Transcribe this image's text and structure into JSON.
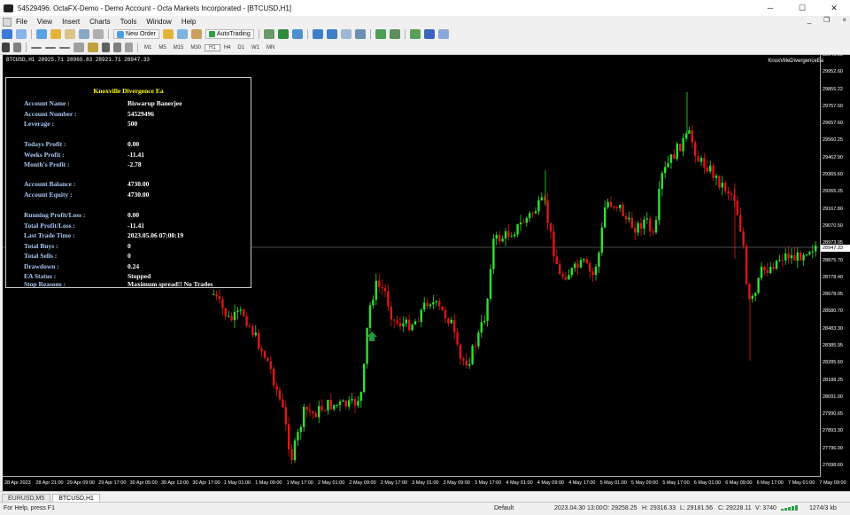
{
  "window": {
    "title": "54529496: OctaFX-Demo - Demo Account - Octa Markets Incorporated - [BTCUSD,H1]",
    "minimize": "─",
    "maximize": "☐",
    "close": "✕"
  },
  "menu": {
    "items": [
      "File",
      "View",
      "Insert",
      "Charts",
      "Tools",
      "Window",
      "Help"
    ],
    "mdi_minimize": "_",
    "mdi_restore": "❐",
    "mdi_close": "×"
  },
  "toolbar": {
    "new_order": "New Order",
    "autotrading": "AutoTrading",
    "timeframes": [
      "M1",
      "M5",
      "M15",
      "M30",
      "H1",
      "H4",
      "D1",
      "W1",
      "MN"
    ]
  },
  "chart": {
    "info": "BTCUSD,H1  28925.71 28965.83 28921.71 28947.33",
    "ea_name": "KnoxVilleDivergenceEa",
    "current_price": "28947.33",
    "colors": {
      "bull": "#2ee02e",
      "bear": "#e01515",
      "background": "#000000",
      "panel_label": "#a7c8f5",
      "panel_title": "#ffff00"
    },
    "price_ticks": [
      "30049.59",
      "29952.60",
      "29855.22",
      "29757.50",
      "29657.60",
      "29560.25",
      "29462.90",
      "29365.60",
      "29265.25",
      "29167.80",
      "29070.50",
      "28973.05",
      "28875.70",
      "28778.40",
      "28678.05",
      "28580.70",
      "28483.30",
      "28385.95",
      "28285.60",
      "28188.25",
      "28091.00",
      "27990.65",
      "27893.30",
      "27796.00",
      "27698.60"
    ],
    "time_ticks": [
      "28 Apr 2023",
      "28 Apr 21:00",
      "29 Apr 09:00",
      "29 Apr 17:00",
      "30 Apr 05:00",
      "30 Apr 13:00",
      "30 Apr 17:00",
      "1 May 01:00",
      "1 May 09:00",
      "1 May 17:00",
      "2 May 01:00",
      "2 May 09:00",
      "2 May 17:00",
      "3 May 01:00",
      "3 May 09:00",
      "3 May 17:00",
      "4 May 01:00",
      "4 May 09:00",
      "4 May 17:00",
      "5 May 01:00",
      "5 May 09:00",
      "5 May 17:00",
      "6 May 01:00",
      "6 May 09:00",
      "6 May 17:00",
      "7 May 01:00",
      "7 May 09:00",
      "7 May 17:00"
    ]
  },
  "panel": {
    "title": "Knoxville Divergence Ea",
    "rows": [
      {
        "label": "Account Name :",
        "value": "Biswarup Banerjee"
      },
      {
        "label": "Account Number :",
        "value": "54529496"
      },
      {
        "label": "Leverage :",
        "value": "500"
      },
      {
        "label": "Todays Profit :",
        "value": "0.00"
      },
      {
        "label": "Weeks Profit :",
        "value": "-11.41"
      },
      {
        "label": "Month's Profit :",
        "value": "-2.78"
      },
      {
        "label": "Account Balance :",
        "value": "4730.00"
      },
      {
        "label": "Account Equity :",
        "value": "4730.00"
      },
      {
        "label": "Running Profit/Loss :",
        "value": "0.00"
      },
      {
        "label": "Total Profit/Loss :",
        "value": "-11.41"
      },
      {
        "label": "Last Trade Time :",
        "value": "2023.05.06 07:08:19"
      },
      {
        "label": "Total Buys :",
        "value": "0"
      },
      {
        "label": "Total Sells :",
        "value": "0"
      },
      {
        "label": "Drawdown :",
        "value": "0.24"
      },
      {
        "label": "EA Status :",
        "value": "Stopped"
      },
      {
        "label": "Stop Reasons :",
        "value": "Maximum spread!! No Trades"
      }
    ]
  },
  "tabs": [
    "EURUSD,M5",
    "BTCUSD,H1"
  ],
  "status": {
    "help": "For Help, press F1",
    "profile": "Default",
    "time": "2023.04.30 13:00",
    "open": "O: 29258.25",
    "high": "H: 29316.33",
    "low": "L: 29181.56",
    "close": "C: 29228.11",
    "volume": "V: 3740",
    "traffic": "1274/3 kb"
  }
}
